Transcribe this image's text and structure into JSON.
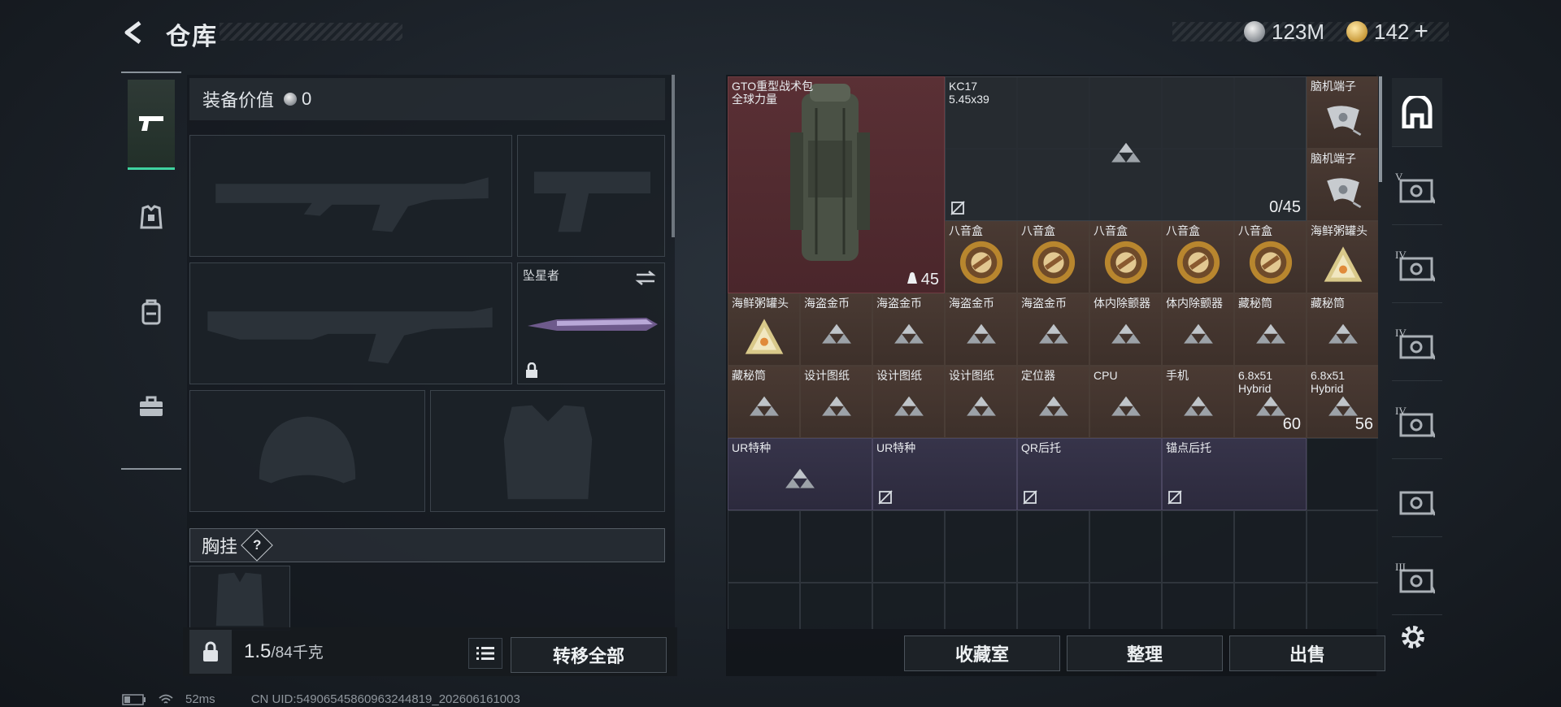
{
  "header": {
    "title": "仓库",
    "currency_silver": "123M",
    "currency_gold": "142",
    "add_label": "+"
  },
  "left_nav": {
    "items": [
      {
        "name": "weapons",
        "icon": "pistol-icon",
        "active": true
      },
      {
        "name": "armor",
        "icon": "vest-badge-icon",
        "active": false
      },
      {
        "name": "backpack",
        "icon": "backpack-icon",
        "active": false
      },
      {
        "name": "case",
        "icon": "briefcase-icon",
        "active": false
      }
    ]
  },
  "equipment": {
    "value_label": "装备价值",
    "value": "0",
    "knife_name": "坠星者",
    "chest_rig_label": "胸挂",
    "help_label": "?"
  },
  "footer": {
    "weight_current": "1.5",
    "weight_max": "/84千克",
    "transfer_all": "转移全部",
    "collection": "收藏室",
    "organize": "整理",
    "sell": "出售"
  },
  "stash": {
    "items": [
      {
        "name": "GTO重型战术包\n全球力量",
        "color": "red",
        "col": 0,
        "row": 0,
        "w": 3,
        "h": 3,
        "count": "45",
        "kind": "backpack"
      },
      {
        "name": "KC17\n5.45x39",
        "color": "dark",
        "col": 3,
        "row": 0,
        "w": 5,
        "h": 2,
        "count": "0/45",
        "kind": "tri",
        "noimg": true
      },
      {
        "name": "脑机端子",
        "color": "brown",
        "col": 8,
        "row": 0,
        "w": 1,
        "h": 1,
        "kind": "device"
      },
      {
        "name": "脑机端子",
        "color": "brown",
        "col": 8,
        "row": 1,
        "w": 1,
        "h": 1,
        "kind": "device"
      },
      {
        "name": "八音盒",
        "color": "brown",
        "col": 3,
        "row": 2,
        "w": 1,
        "h": 1,
        "kind": "musicbox"
      },
      {
        "name": "八音盒",
        "color": "brown",
        "col": 4,
        "row": 2,
        "w": 1,
        "h": 1,
        "kind": "musicbox"
      },
      {
        "name": "八音盒",
        "color": "brown",
        "col": 5,
        "row": 2,
        "w": 1,
        "h": 1,
        "kind": "musicbox"
      },
      {
        "name": "八音盒",
        "color": "brown",
        "col": 6,
        "row": 2,
        "w": 1,
        "h": 1,
        "kind": "musicbox"
      },
      {
        "name": "八音盒",
        "color": "brown",
        "col": 7,
        "row": 2,
        "w": 1,
        "h": 1,
        "kind": "musicbox"
      },
      {
        "name": "海鲜粥罐头",
        "color": "brown",
        "col": 8,
        "row": 2,
        "w": 1,
        "h": 1,
        "kind": "can"
      },
      {
        "name": "海鲜粥罐头",
        "color": "brown",
        "col": 0,
        "row": 3,
        "w": 1,
        "h": 1,
        "kind": "can"
      },
      {
        "name": "海盗金币",
        "color": "brown",
        "col": 1,
        "row": 3,
        "w": 1,
        "h": 1,
        "kind": "tri"
      },
      {
        "name": "海盗金币",
        "color": "brown",
        "col": 2,
        "row": 3,
        "w": 1,
        "h": 1,
        "kind": "tri"
      },
      {
        "name": "海盗金币",
        "color": "brown",
        "col": 3,
        "row": 3,
        "w": 1,
        "h": 1,
        "kind": "tri"
      },
      {
        "name": "海盗金币",
        "color": "brown",
        "col": 4,
        "row": 3,
        "w": 1,
        "h": 1,
        "kind": "tri"
      },
      {
        "name": "体内除颤器",
        "color": "brown",
        "col": 5,
        "row": 3,
        "w": 1,
        "h": 1,
        "kind": "tri"
      },
      {
        "name": "体内除颤器",
        "color": "brown",
        "col": 6,
        "row": 3,
        "w": 1,
        "h": 1,
        "kind": "tri"
      },
      {
        "name": "藏秘筒",
        "color": "brown",
        "col": 7,
        "row": 3,
        "w": 1,
        "h": 1,
        "kind": "tri"
      },
      {
        "name": "藏秘筒",
        "color": "brown",
        "col": 8,
        "row": 3,
        "w": 1,
        "h": 1,
        "kind": "tri"
      },
      {
        "name": "藏秘筒",
        "color": "brown",
        "col": 0,
        "row": 4,
        "w": 1,
        "h": 1,
        "kind": "tri"
      },
      {
        "name": "设计图纸",
        "color": "brown",
        "col": 1,
        "row": 4,
        "w": 1,
        "h": 1,
        "kind": "tri"
      },
      {
        "name": "设计图纸",
        "color": "brown",
        "col": 2,
        "row": 4,
        "w": 1,
        "h": 1,
        "kind": "tri"
      },
      {
        "name": "设计图纸",
        "color": "brown",
        "col": 3,
        "row": 4,
        "w": 1,
        "h": 1,
        "kind": "tri"
      },
      {
        "name": "定位器",
        "color": "brown",
        "col": 4,
        "row": 4,
        "w": 1,
        "h": 1,
        "kind": "tri"
      },
      {
        "name": "CPU",
        "color": "brown",
        "col": 5,
        "row": 4,
        "w": 1,
        "h": 1,
        "kind": "tri"
      },
      {
        "name": "手机",
        "color": "brown",
        "col": 6,
        "row": 4,
        "w": 1,
        "h": 1,
        "kind": "tri"
      },
      {
        "name": "6.8x51\nHybrid",
        "color": "brown",
        "col": 7,
        "row": 4,
        "w": 1,
        "h": 1,
        "kind": "tri",
        "count": "60"
      },
      {
        "name": "6.8x51\nHybrid",
        "color": "brown",
        "col": 8,
        "row": 4,
        "w": 1,
        "h": 1,
        "kind": "tri",
        "count": "56"
      },
      {
        "name": "UR特种",
        "color": "purple",
        "col": 0,
        "row": 5,
        "w": 2,
        "h": 1,
        "kind": "tri"
      },
      {
        "name": "UR特种",
        "color": "purple",
        "col": 2,
        "row": 5,
        "w": 2,
        "h": 1,
        "kind": "none",
        "noimg": true
      },
      {
        "name": "QR后托",
        "color": "purple",
        "col": 4,
        "row": 5,
        "w": 2,
        "h": 1,
        "kind": "none",
        "noimg": true
      },
      {
        "name": "锚点后托",
        "color": "purple",
        "col": 6,
        "row": 5,
        "w": 2,
        "h": 1,
        "kind": "none",
        "noimg": true
      }
    ]
  },
  "right_tabs": [
    {
      "label": "",
      "icon": "stash-home-icon",
      "active": true
    },
    {
      "label": "V",
      "icon": "safe-v-icon"
    },
    {
      "label": "IV",
      "icon": "safe-iv-icon"
    },
    {
      "label": "IV",
      "icon": "safe-iv-icon"
    },
    {
      "label": "IV",
      "icon": "cabinet-iv-icon"
    },
    {
      "label": "",
      "icon": "display-case-icon"
    },
    {
      "label": "III",
      "icon": "workbench-iii-icon"
    }
  ],
  "status": {
    "ping": "52ms",
    "uid": "CN UID:549065458609632448​19_202606161003"
  }
}
